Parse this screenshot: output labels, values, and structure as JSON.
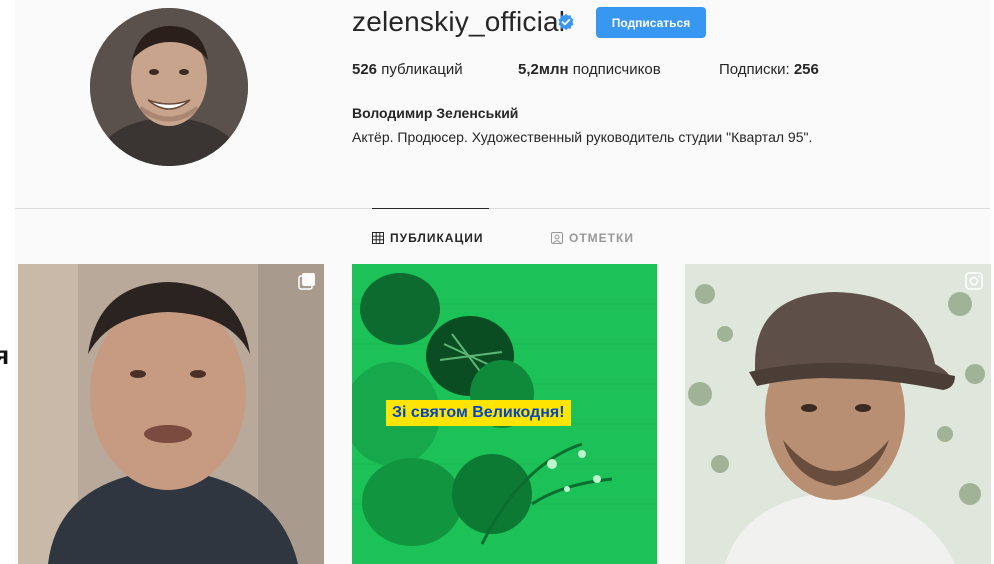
{
  "profile": {
    "username": "zelenskiy_official",
    "follow_label": "Подписаться",
    "full_name": "Володимир Зеленський",
    "bio": "Актёр. Продюсер. Художественный руководитель студии \"Квартал 95\".",
    "stats": {
      "posts_value": "526",
      "posts_label": " публикаций",
      "followers_value": "5,2млн",
      "followers_label": " подписчиков",
      "following_label": "Подписки: ",
      "following_value": "256"
    }
  },
  "tabs": {
    "posts": "ПУБЛИКАЦИИ",
    "tagged": "ОТМЕТКИ"
  },
  "posts": [
    {
      "type": "carousel",
      "icon": "multiple-images-icon"
    },
    {
      "type": "image",
      "banner": "Зі святом Великодня!"
    },
    {
      "type": "video",
      "icon": "video-icon"
    }
  ],
  "stray_char": "я",
  "colors": {
    "accent": "#3897f0",
    "verified": "#3897f0",
    "background": "#fafafa",
    "banner_yellow": "#ffe500",
    "banner_text": "#0046c9",
    "easter_green": "#1cc158"
  }
}
